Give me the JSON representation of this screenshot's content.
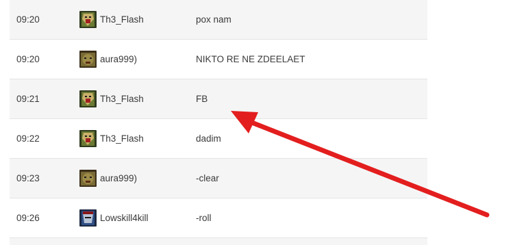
{
  "chat": {
    "rows": [
      {
        "time": "09:20",
        "player": "Th3_Flash",
        "message": "pox nam",
        "avatar_icon": "hero-avatar-green-orc-icon"
      },
      {
        "time": "09:20",
        "player": "aura999)",
        "message": "NIKTO RE NE ZDEELAET",
        "avatar_icon": "hero-avatar-troll-icon"
      },
      {
        "time": "09:21",
        "player": "Th3_Flash",
        "message": "FB",
        "avatar_icon": "hero-avatar-green-orc-icon"
      },
      {
        "time": "09:22",
        "player": "Th3_Flash",
        "message": "dadim",
        "avatar_icon": "hero-avatar-green-orc-icon"
      },
      {
        "time": "09:23",
        "player": "aura999)",
        "message": "-clear",
        "avatar_icon": "hero-avatar-troll-icon"
      },
      {
        "time": "09:26",
        "player": "Lowskill4kill",
        "message": "-roll",
        "avatar_icon": "hero-avatar-blue-knight-icon"
      }
    ]
  },
  "annotation": {
    "icon": "red-arrow-icon",
    "color": "#e31e1e"
  }
}
